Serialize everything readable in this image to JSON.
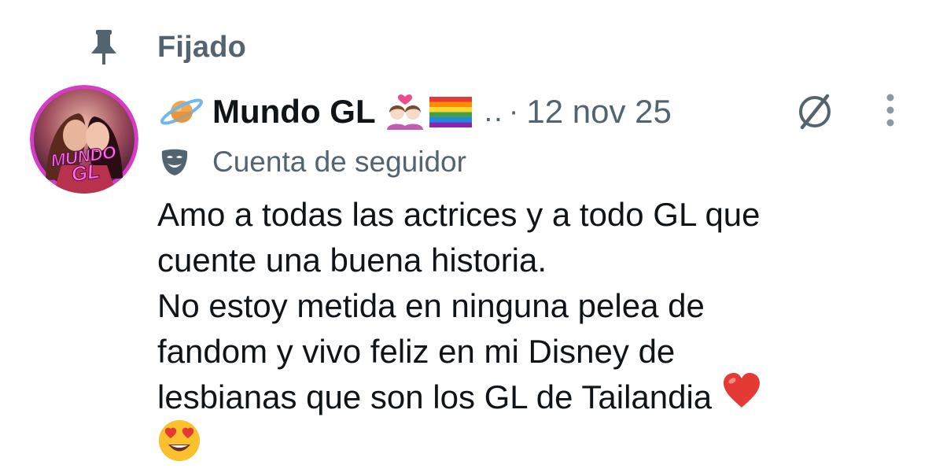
{
  "pinned": {
    "label": "Fijado",
    "icon": "pin-icon"
  },
  "author": {
    "avatar_text": "MUNDO GL",
    "planet_icon": "ringed-planet-icon",
    "name": "Mundo GL",
    "name_emojis": [
      "couple-with-heart-women-emoji",
      "rainbow-flag-emoji"
    ],
    "truncation": "..",
    "separator": "·",
    "date": "12 nov 25"
  },
  "account_label": {
    "icon": "performing-arts-mask-icon",
    "text": "Cuenta de seguidor"
  },
  "actions": {
    "grok_icon": "grok-icon",
    "more_icon": "more-vertical-icon"
  },
  "post": {
    "lines": [
      "Amo a todas las actrices y a todo GL que",
      "cuente una buena historia.",
      "No estoy metida en ninguna pelea de",
      "fandom y vivo feliz en mi Disney de",
      "lesbianas que son los GL de Tailandia"
    ],
    "emojis": [
      "red-heart-emoji",
      "heart-eyes-emoji"
    ]
  },
  "colors": {
    "text_primary": "#0f1419",
    "text_secondary": "#536471",
    "background": "#ffffff"
  }
}
